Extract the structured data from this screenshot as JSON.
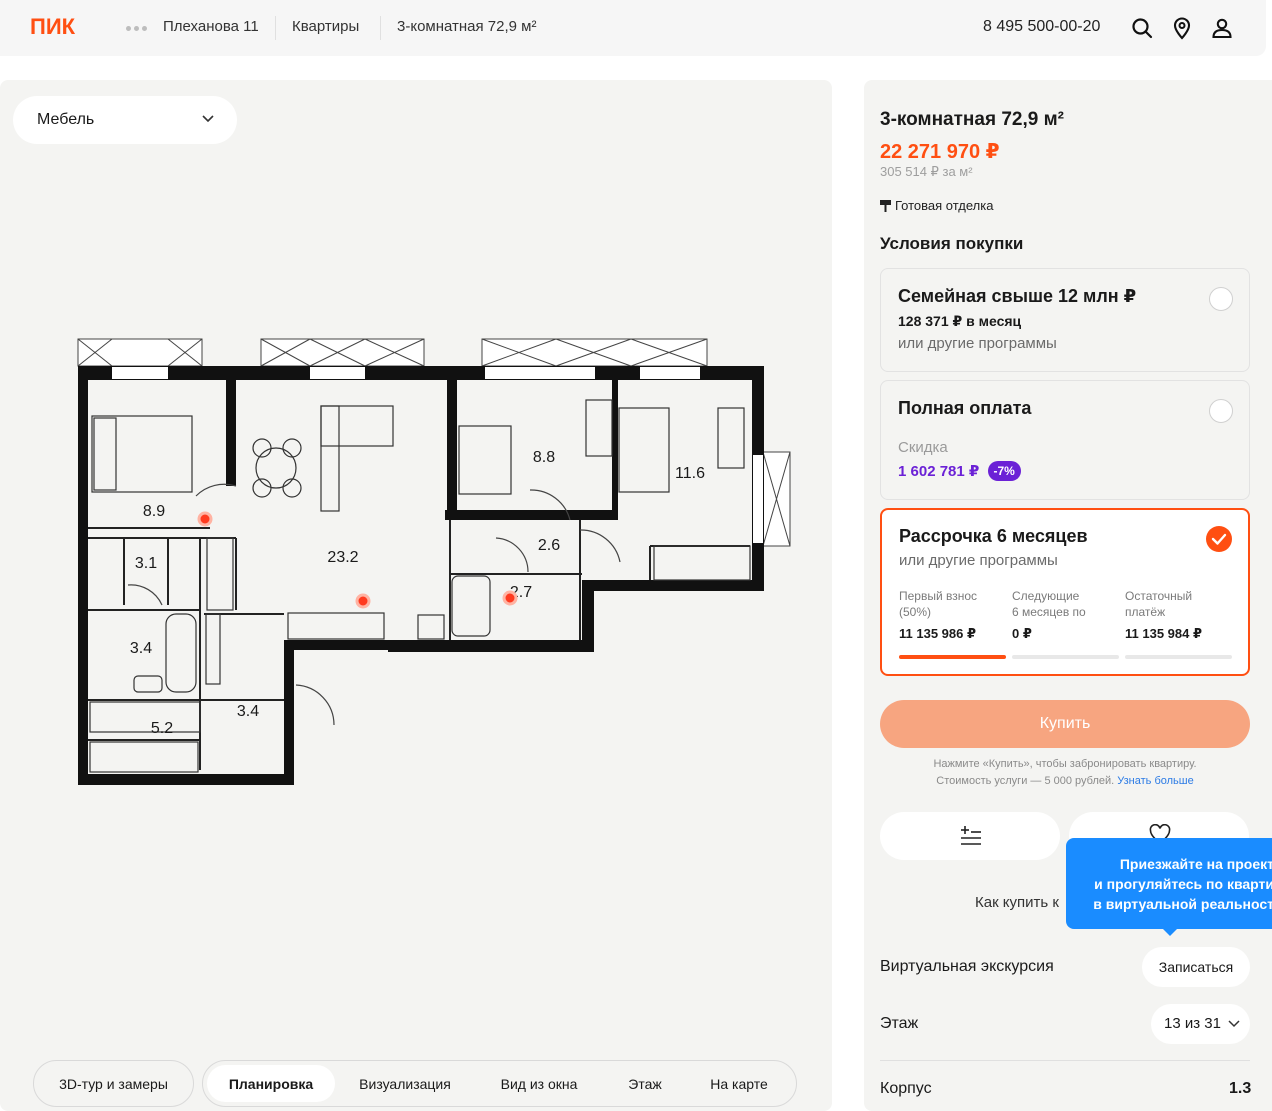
{
  "header": {
    "logo": "ПИК",
    "breadcrumbs": [
      "Плеханова 11",
      "Квартиры",
      "3-комнатная 72,9 м²"
    ],
    "phone": "8 495 500-00-20",
    "brand_color": "#ff4f12"
  },
  "plan": {
    "furniture_select": "Мебель",
    "rooms": [
      "8.9",
      "23.2",
      "8.8",
      "11.6",
      "2.6",
      "2.7",
      "3.1",
      "3.4",
      "3.4",
      "5.2"
    ],
    "tour_button": "3D-тур и замеры",
    "tabs": [
      "Планировка",
      "Визуализация",
      "Вид из окна",
      "Этаж",
      "На карте"
    ],
    "active_tab": "Планировка"
  },
  "side": {
    "title": "3-комнатная 72,9 м²",
    "price": "22 271 970 ₽",
    "price_per_sqm": "305 514 ₽ за м²",
    "finish": "Готовая отделка",
    "conditions_title": "Условия покупки",
    "options": [
      {
        "title": "Семейная свыше 12 млн ₽",
        "monthly": "128 371 ₽ в месяц",
        "sub": "или другие программы"
      },
      {
        "title": "Полная оплата",
        "discount_label": "Скидка",
        "discount_value": "1 602 781 ₽",
        "discount_badge": "-7%"
      },
      {
        "title": "Рассрочка 6 месяцев",
        "sub": "или другие программы",
        "columns": [
          {
            "head1": "Первый взнос",
            "head2": "(50%)",
            "value": "11 135 986 ₽"
          },
          {
            "head1": "Следующие",
            "head2": "6 месяцев по",
            "value": "0 ₽"
          },
          {
            "head1": "Остаточный",
            "head2": "платёж",
            "value": "11 135 984 ₽"
          }
        ]
      }
    ],
    "buy_button": "Купить",
    "buy_note_line1": "Нажмите «Купить», чтобы забронировать квартиру.",
    "buy_note_line2": "Стоимость услуги — 5 000 рублей.",
    "buy_note_link": "Узнать больше",
    "how_to_buy": "Как купить к",
    "virtual_tour_label": "Виртуальная экскурсия",
    "virtual_tour_button": "Записаться",
    "floor_label": "Этаж",
    "floor_value": "13 из 31",
    "building_label": "Корпус",
    "building_value": "1.3"
  },
  "tooltip": {
    "line1": "Приезжайте на проект",
    "line2": "и прогуляйтесь по кварти",
    "line3": "в виртуальной реальност"
  }
}
